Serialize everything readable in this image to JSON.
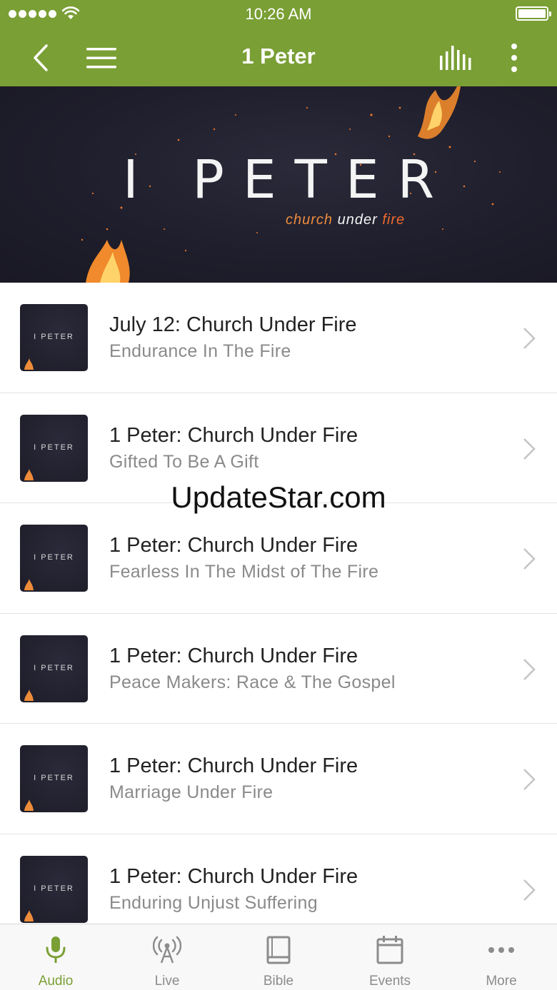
{
  "status_bar": {
    "time": "10:26 AM"
  },
  "nav": {
    "title": "1 Peter"
  },
  "banner": {
    "title": "I PETER",
    "subtitle_words": [
      "church",
      "under",
      "fire"
    ]
  },
  "thumbnail_text": "I PETER",
  "sermons": [
    {
      "title": "July 12: Church Under Fire",
      "subtitle": "Endurance In The Fire"
    },
    {
      "title": "1 Peter: Church Under Fire",
      "subtitle": "Gifted To Be A Gift"
    },
    {
      "title": "1 Peter: Church Under Fire",
      "subtitle": "Fearless In The Midst of The Fire"
    },
    {
      "title": "1 Peter: Church Under Fire",
      "subtitle": "Peace Makers: Race & The Gospel"
    },
    {
      "title": "1 Peter: Church Under Fire",
      "subtitle": "Marriage Under Fire"
    },
    {
      "title": "1 Peter: Church Under Fire",
      "subtitle": "Enduring Unjust Suffering"
    }
  ],
  "watermark": "UpdateStar.com",
  "tabs": [
    {
      "label": "Audio",
      "icon": "microphone-icon",
      "active": true
    },
    {
      "label": "Live",
      "icon": "broadcast-icon",
      "active": false
    },
    {
      "label": "Bible",
      "icon": "book-icon",
      "active": false
    },
    {
      "label": "Events",
      "icon": "calendar-icon",
      "active": false
    },
    {
      "label": "More",
      "icon": "more-dots-icon",
      "active": false
    }
  ],
  "colors": {
    "brand": "#7a9f35",
    "inactive": "#8c8c8c",
    "banner_bg": "#1f1e2c",
    "fire_orange": "#ef8c3a"
  }
}
